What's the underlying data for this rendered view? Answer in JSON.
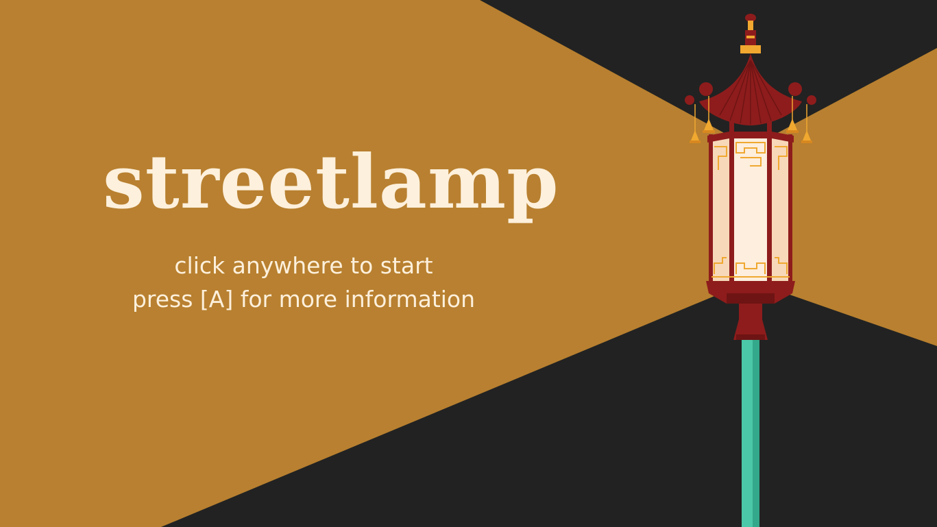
{
  "title": "streetlamp",
  "subtitle_lines": [
    "click anywhere to start",
    "press [A] for more information"
  ],
  "colors": {
    "background_dark": "#222222",
    "light_beam": "#b88030",
    "text": "#fdf0dc",
    "lamp_red": "#8e1c1c",
    "lamp_gold": "#f0a830",
    "lamp_glass": "#fdeedd",
    "pole_teal": "#4ac8a8"
  },
  "icons": {
    "lamp": "chinese-pagoda-streetlamp"
  }
}
